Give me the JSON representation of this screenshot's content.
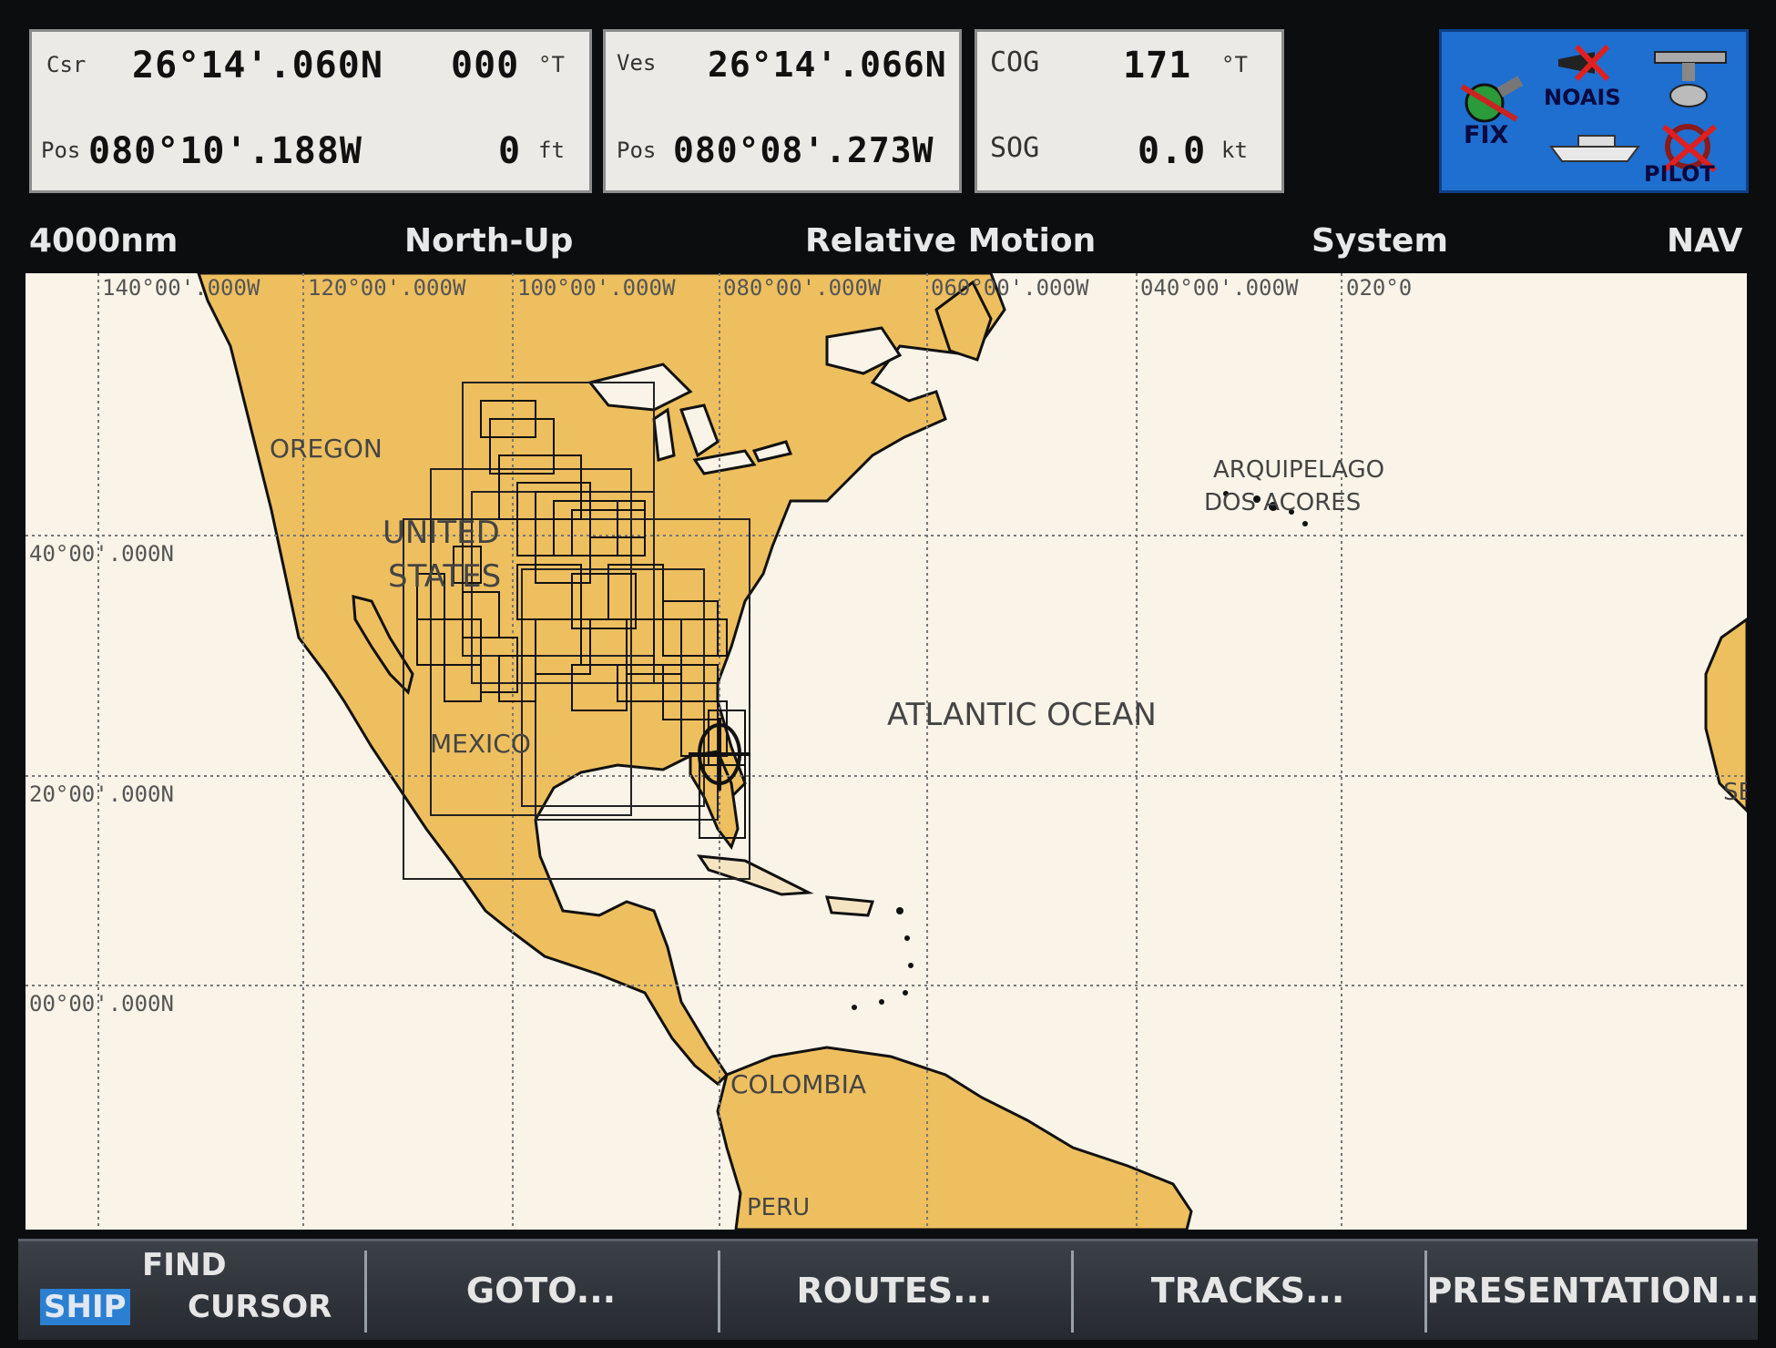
{
  "panels": {
    "csr": {
      "label_top": "Csr",
      "lat": "26°14'.060N",
      "heading": "000",
      "heading_unit": "°T",
      "label_bottom": "Pos",
      "lon": "080°10'.188W",
      "depth": "0",
      "depth_unit": "ft"
    },
    "ves": {
      "label_top": "Ves",
      "lat": "26°14'.066N",
      "label_bottom": "Pos",
      "lon": "080°08'.273W"
    },
    "nav": {
      "cog_label": "COG",
      "cog": "171",
      "cog_unit": "°T",
      "sog_label": "SOG",
      "sog": "0.0",
      "sog_unit": "kt"
    }
  },
  "status": {
    "fix": "FIX",
    "noais": "NOAIS",
    "pilot": "PILOT"
  },
  "modebar": {
    "range": "4000nm",
    "orientation": "North-Up",
    "motion": "Relative Motion",
    "system": "System",
    "nav": "NAV"
  },
  "map": {
    "lon_labels": [
      "140°00'.000W",
      "120°00'.000W",
      "100°00'.000W",
      "080°00'.000W",
      "060°00'.000W",
      "040°00'.000W",
      "020°0"
    ],
    "lat_labels": [
      "40°00'.000N",
      "20°00'.000N",
      "00°00'.000N"
    ],
    "place_labels": {
      "oregon": "OREGON",
      "united": "UNITED",
      "states": "STATES",
      "mexico": "MEXICO",
      "atlantic": "ATLANTIC OCEAN",
      "acores1": "ARQUIPELAGO",
      "acores2": "DOS ACORES",
      "colombia": "COLOMBIA",
      "peru": "PERU",
      "se": "SE"
    },
    "land_color": "#eebf5f",
    "sea_color": "#f9f3e8"
  },
  "softkeys": {
    "ship": "SHIP",
    "find": "FIND",
    "cursor": "CURSOR",
    "goto": "GOTO...",
    "routes": "ROUTES...",
    "tracks": "TRACKS...",
    "presentation": "PRESENTATION..."
  }
}
